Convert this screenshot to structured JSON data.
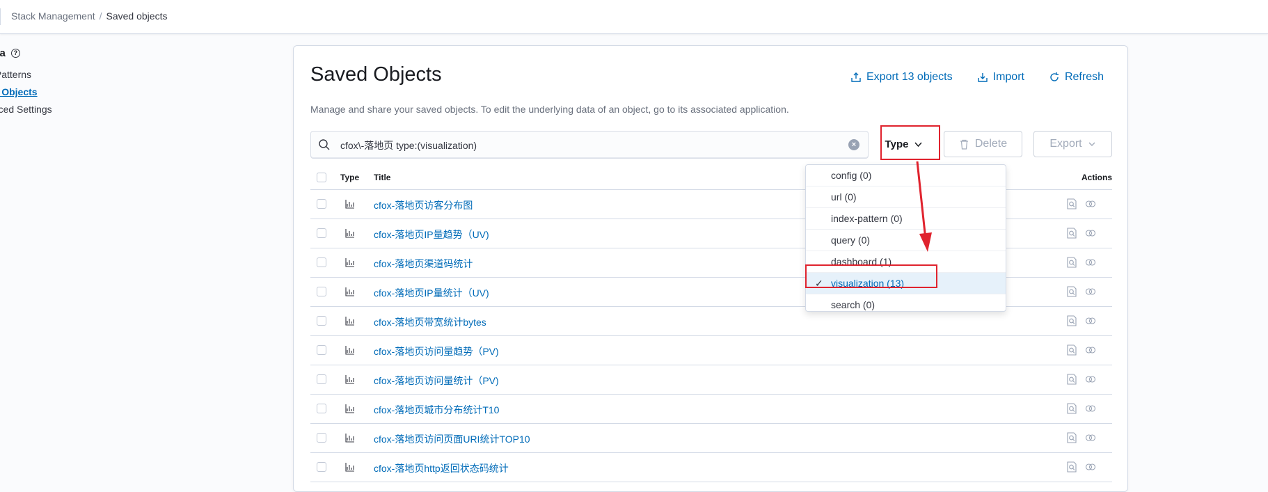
{
  "breadcrumb": {
    "parent": "Stack Management",
    "separator": "/",
    "current": "Saved objects"
  },
  "sidenav": {
    "group": "ana",
    "items": [
      {
        "label": "x Patterns",
        "active": false
      },
      {
        "label": "ed Objects",
        "active": true
      },
      {
        "label": "anced Settings",
        "active": false
      }
    ]
  },
  "page": {
    "title": "Saved Objects",
    "description": "Manage and share your saved objects. To edit the underlying data of an object, go to its associated application.",
    "export_all_label": "Export 13 objects",
    "import_label": "Import",
    "refresh_label": "Refresh"
  },
  "search": {
    "value": "cfox\\-落地页 type:(visualization)"
  },
  "filters": {
    "type_label": "Type",
    "delete_label": "Delete",
    "export_label": "Export"
  },
  "table": {
    "headers": {
      "type": "Type",
      "title": "Title",
      "actions": "Actions"
    },
    "rows": [
      "cfox-落地页访客分布图",
      "cfox-落地页IP量趋势（UV)",
      "cfox-落地页渠道码统计",
      "cfox-落地页IP量统计（UV)",
      "cfox-落地页带宽统计bytes",
      "cfox-落地页访问量趋势（PV)",
      "cfox-落地页访问量统计（PV)",
      "cfox-落地页城市分布统计T10",
      "cfox-落地页访问页面URI统计TOP10",
      "cfox-落地页http返回状态码统计"
    ]
  },
  "type_dropdown": {
    "options": [
      {
        "label": "config (0)",
        "selected": false
      },
      {
        "label": "url (0)",
        "selected": false
      },
      {
        "label": "index-pattern (0)",
        "selected": false
      },
      {
        "label": "query (0)",
        "selected": false
      },
      {
        "label": "dashboard (1)",
        "selected": false
      },
      {
        "label": "visualization (13)",
        "selected": true
      },
      {
        "label": "search (0)",
        "selected": false
      }
    ],
    "check_glyph": "✓"
  },
  "colors": {
    "link": "#006bb8",
    "highlight_border": "#e0232e",
    "selected_bg": "#e6f1fa"
  },
  "icons": {
    "search": "search-icon",
    "clear": "clear-icon",
    "export": "export-icon",
    "import": "import-icon",
    "refresh": "refresh-icon",
    "chevron": "chevron-down-icon",
    "delete": "trash-icon",
    "row_type": "visualization-icon",
    "inspect": "inspect-icon",
    "relationships": "relationships-icon"
  }
}
